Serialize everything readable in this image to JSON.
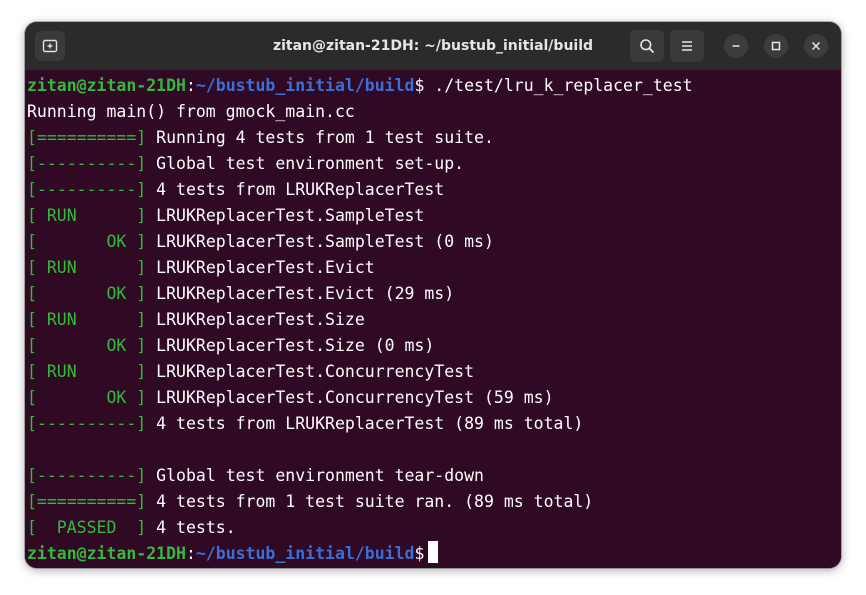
{
  "window": {
    "title": "zitan@zitan-21DH: ~/bustub_initial/build",
    "new_tab_icon": "new-tab-icon",
    "search_icon": "search-icon",
    "menu_icon": "hamburger-menu-icon",
    "minimize_icon": "minimize-icon",
    "maximize_icon": "maximize-icon",
    "close_icon": "close-icon"
  },
  "colors": {
    "background": "#300a24",
    "green": "#33ba3a",
    "blue": "#3b6fd8",
    "text": "#ffffff"
  },
  "prompt": {
    "user_host": "zitan@zitan-21DH",
    "colon": ":",
    "path": "~/bustub_initial/build",
    "dollar": "$",
    "command": " ./test/lru_k_replacer_test"
  },
  "output": {
    "l1": "Running main() from gmock_main.cc",
    "l2_tag": "[==========]",
    "l2_text": " Running 4 tests from 1 test suite.",
    "l3_tag": "[----------]",
    "l3_text": " Global test environment set-up.",
    "l4_tag": "[----------]",
    "l4_text": " 4 tests from LRUKReplacerTest",
    "l5_tag": "[ RUN      ]",
    "l5_text": " LRUKReplacerTest.SampleTest",
    "l6_tag": "[       OK ]",
    "l6_text": " LRUKReplacerTest.SampleTest (0 ms)",
    "l7_tag": "[ RUN      ]",
    "l7_text": " LRUKReplacerTest.Evict",
    "l8_tag": "[       OK ]",
    "l8_text": " LRUKReplacerTest.Evict (29 ms)",
    "l9_tag": "[ RUN      ]",
    "l9_text": " LRUKReplacerTest.Size",
    "l10_tag": "[       OK ]",
    "l10_text": " LRUKReplacerTest.Size (0 ms)",
    "l11_tag": "[ RUN      ]",
    "l11_text": " LRUKReplacerTest.ConcurrencyTest",
    "l12_tag": "[       OK ]",
    "l12_text": " LRUKReplacerTest.ConcurrencyTest (59 ms)",
    "l13_tag": "[----------]",
    "l13_text": " 4 tests from LRUKReplacerTest (89 ms total)",
    "l15_tag": "[----------]",
    "l15_text": " Global test environment tear-down",
    "l16_tag": "[==========]",
    "l16_text": " 4 tests from 1 test suite ran. (89 ms total)",
    "l17_tag": "[  PASSED  ]",
    "l17_text": " 4 tests."
  }
}
